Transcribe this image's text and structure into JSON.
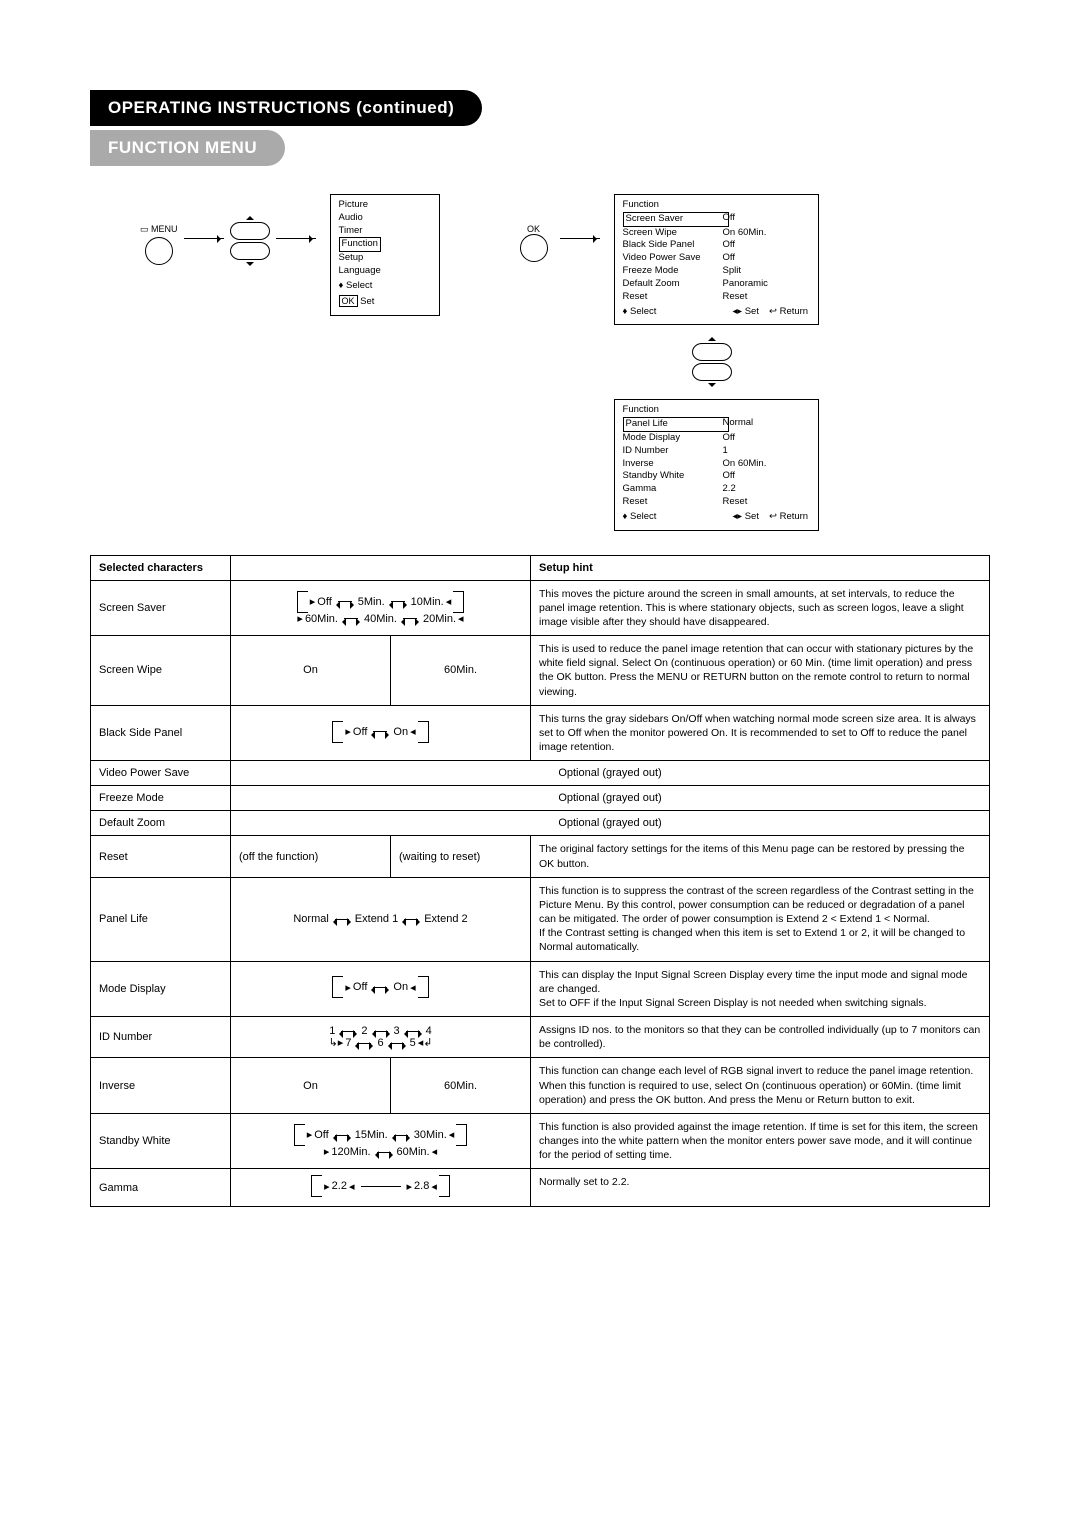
{
  "headings": {
    "main": "OPERATING INSTRUCTIONS (continued)",
    "sub": "FUNCTION MENU"
  },
  "remote": {
    "menuLabel": "MENU",
    "okLabel": "OK"
  },
  "osdMenu": {
    "items": [
      "Picture",
      "Audio",
      "Timer",
      "Function",
      "Setup",
      "Language"
    ],
    "selected": "Function",
    "footerSelect": "Select",
    "footerSet": "Set",
    "setKey": "OK"
  },
  "osdFunction1": {
    "title": "Function",
    "rows": [
      {
        "label": "Screen Saver",
        "value": "Off",
        "selected": true
      },
      {
        "label": "Screen Wipe",
        "value": "On  60Min."
      },
      {
        "label": "Black Side Panel",
        "value": "Off"
      },
      {
        "label": "Video Power Save",
        "value": "Off"
      },
      {
        "label": "Freeze Mode",
        "value": "Split"
      },
      {
        "label": "Default Zoom",
        "value": "Panoramic"
      },
      {
        "label": "Reset",
        "value": "Reset"
      }
    ],
    "footer": {
      "select": "Select",
      "set": "Set",
      "return": "Return"
    }
  },
  "osdFunction2": {
    "title": "Function",
    "rows": [
      {
        "label": "Panel Life",
        "value": "Normal",
        "selected": true
      },
      {
        "label": "Mode Display",
        "value": "Off"
      },
      {
        "label": "ID Number",
        "value": "1"
      },
      {
        "label": "Inverse",
        "value": "On  60Min."
      },
      {
        "label": "Standby White",
        "value": "Off"
      },
      {
        "label": "Gamma",
        "value": "2.2"
      },
      {
        "label": "Reset",
        "value": "Reset"
      }
    ],
    "footer": {
      "select": "Select",
      "set": "Set",
      "return": "Return"
    }
  },
  "tableHeaders": {
    "selected": "Selected characters",
    "hint": "Setup hint"
  },
  "table": {
    "screenSaver": {
      "name": "Screen Saver",
      "opts1": [
        "Off",
        "5Min.",
        "10Min."
      ],
      "opts2": [
        "60Min.",
        "40Min.",
        "20Min."
      ],
      "hint": "This moves the picture around the screen in small amounts, at set intervals, to reduce the panel image retention. This is where stationary objects, such as screen logos, leave a slight image visible after they should have disappeared."
    },
    "screenWipe": {
      "name": "Screen Wipe",
      "opt1": "On",
      "opt2": "60Min.",
      "hint": "This is used to reduce the panel image retention that can occur with stationary pictures by the white field signal. Select On (continuous operation) or 60 Min. (time limit operation) and press the OK button. Press the MENU or RETURN button on the remote control to return to normal viewing."
    },
    "blackSide": {
      "name": "Black Side Panel",
      "opts": [
        "Off",
        "On"
      ],
      "hint": "This turns the gray sidebars On/Off when watching normal mode screen size area. It is always set to Off when the monitor powered On. It is recommended to set to Off to reduce the panel image retention."
    },
    "videoPowerSave": {
      "name": "Video Power Save",
      "hint": "Optional (grayed out)"
    },
    "freezeMode": {
      "name": "Freeze Mode",
      "hint": "Optional (grayed out)"
    },
    "defaultZoom": {
      "name": "Default Zoom",
      "hint": "Optional (grayed out)"
    },
    "reset": {
      "name": "Reset",
      "col1": "(off the function)",
      "col2": "(waiting to reset)",
      "hint": "The original factory settings for the items of this Menu page can be restored by pressing the OK button."
    },
    "panelLife": {
      "name": "Panel Life",
      "opts": [
        "Normal",
        "Extend 1",
        "Extend 2"
      ],
      "hint": "This function is to suppress the contrast of the screen regardless of the Contrast setting in the Picture Menu. By this control, power consumption can be reduced or degradation of a panel can be mitigated. The order of power consumption is Extend 2 < Extend 1 < Normal.\nIf the Contrast setting is changed when this item is set to Extend 1 or 2, it will be changed to Normal automatically."
    },
    "modeDisplay": {
      "name": "Mode Display",
      "opts": [
        "Off",
        "On"
      ],
      "hint": "This can display the Input Signal Screen Display every time the input mode and signal mode are changed.\nSet to OFF if the Input Signal Screen Display is not needed when switching signals."
    },
    "idNumber": {
      "name": "ID Number",
      "opts1": [
        "1",
        "2",
        "3",
        "4"
      ],
      "opts2": [
        "7",
        "6",
        "5"
      ],
      "hint": "Assigns ID nos. to the monitors so that they can be controlled individually (up to 7 monitors can be controlled)."
    },
    "inverse": {
      "name": "Inverse",
      "opt1": "On",
      "opt2": "60Min.",
      "hint": "This function can change each level of RGB signal invert to reduce the panel image retention. When this function is required to use, select On (continuous operation) or 60Min. (time limit operation) and press the OK button. And press the Menu or Return button to exit."
    },
    "standbyWhite": {
      "name": "Standby White",
      "opts1": [
        "Off",
        "15Min.",
        "30Min."
      ],
      "opts2": [
        "120Min.",
        "60Min."
      ],
      "hint": "This function is also provided against the image retention. If time is set for this item, the screen changes into the white pattern when the monitor enters power save mode, and it will continue for the period of setting time."
    },
    "gamma": {
      "name": "Gamma",
      "opts": [
        "2.2",
        "2.8"
      ],
      "hint": "Normally set to 2.2."
    }
  }
}
